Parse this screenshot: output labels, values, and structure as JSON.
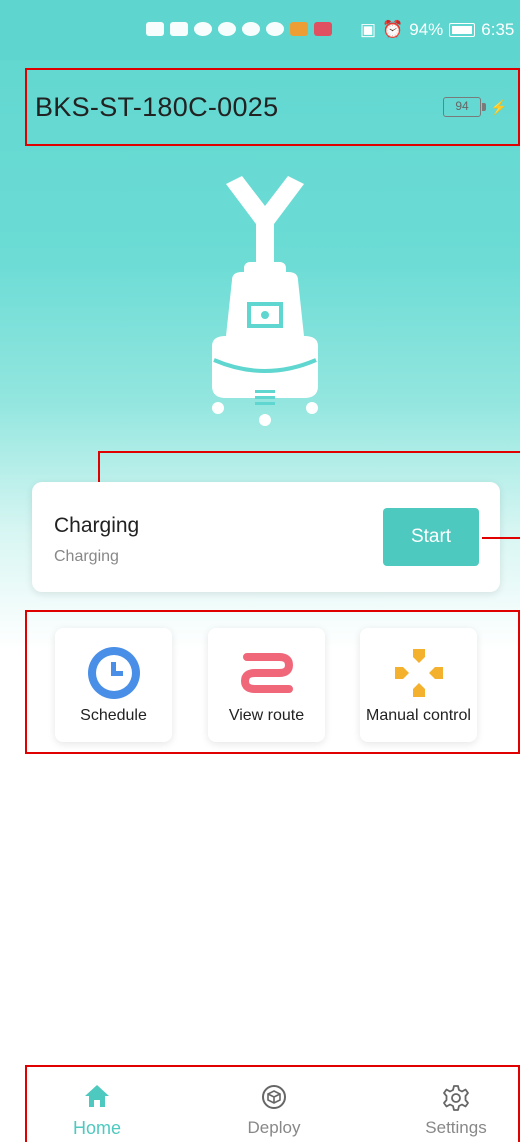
{
  "status_bar": {
    "battery_percent": "94%",
    "time": "6:35"
  },
  "header": {
    "device_name": "BKS-ST-180C-0025",
    "battery_level": "94"
  },
  "status_card": {
    "title": "Charging",
    "subtitle": "Charging",
    "start_label": "Start"
  },
  "actions": [
    {
      "label": "Schedule",
      "icon": "clock-icon",
      "color": "#4a8fe7"
    },
    {
      "label": "View route",
      "icon": "route-icon",
      "color": "#f0677a"
    },
    {
      "label": "Manual control",
      "icon": "dpad-icon",
      "color": "#f4b12e"
    }
  ],
  "nav": [
    {
      "label": "Home",
      "icon": "home-icon",
      "active": true
    },
    {
      "label": "Deploy",
      "icon": "cube-icon",
      "active": false
    },
    {
      "label": "Settings",
      "icon": "gear-icon",
      "active": false
    }
  ],
  "colors": {
    "accent": "#4ec9bf",
    "annotation": "#e00000"
  }
}
